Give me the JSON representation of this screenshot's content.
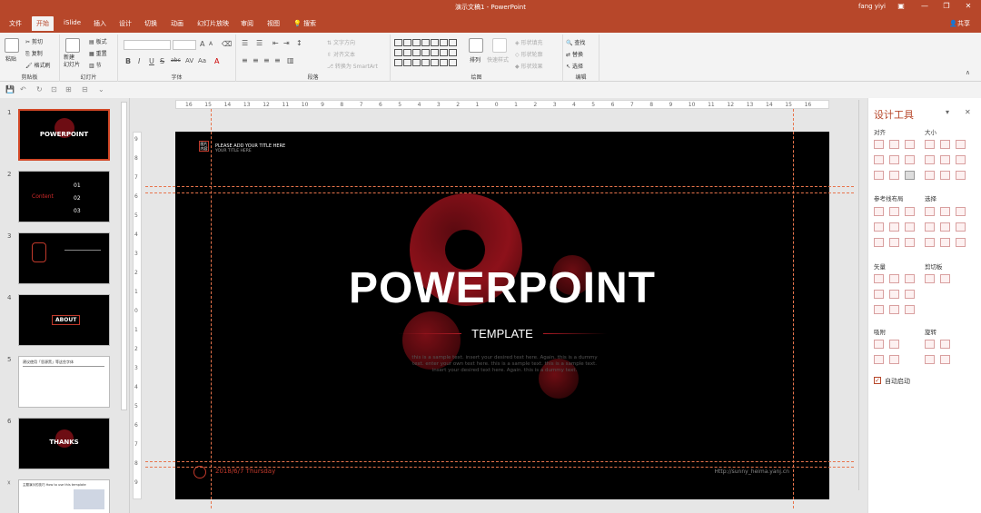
{
  "window": {
    "title": "演示文稿1 - PowerPoint",
    "user": "fang yiyi",
    "share_label": "共享"
  },
  "tabs": [
    "文件",
    "开始",
    "iSlide",
    "插入",
    "设计",
    "切换",
    "动画",
    "幻灯片放映",
    "审阅",
    "视图",
    "搜索"
  ],
  "active_tab": "开始",
  "ribbon": {
    "clipboard": {
      "paste": "粘贴",
      "cut": "剪切",
      "copy": "复制",
      "format_painter": "格式刷",
      "label": "剪贴板"
    },
    "slides": {
      "new_slide": "新建\n幻灯片",
      "layout": "板式",
      "reset": "重置",
      "section": "节",
      "label": "幻灯片"
    },
    "font": {
      "label": "字体",
      "bold": "B",
      "italic": "I",
      "underline": "U",
      "strike": "S",
      "abc": "abc",
      "aa": "Aa"
    },
    "paragraph": {
      "text_direction": "文字方向",
      "align_text": "对齐文本",
      "smartart": "转换为 SmartArt",
      "label": "段落"
    },
    "drawing": {
      "arrange": "排列",
      "quick_styles": "快速样式",
      "shape_fill": "形状填充",
      "shape_outline": "形状轮廓",
      "shape_effects": "形状效果",
      "label": "绘图"
    },
    "editing": {
      "find": "查找",
      "replace": "替换",
      "select": "选择",
      "label": "编辑"
    }
  },
  "thumbnails": [
    {
      "num": "1",
      "title": "POWERPOINT",
      "selected": true
    },
    {
      "num": "2",
      "title": "Content",
      "items": [
        "01",
        "02",
        "03"
      ]
    },
    {
      "num": "3",
      "title": ""
    },
    {
      "num": "4",
      "title": "ABOUT"
    },
    {
      "num": "5",
      "title": "建议使用「思源黑」等这些字体"
    },
    {
      "num": "6",
      "title": "THANKS"
    },
    {
      "num": "7",
      "title": "主题演示的技巧 How to use this template"
    }
  ],
  "ruler": {
    "h_ticks": [
      "16",
      "15",
      "14",
      "13",
      "12",
      "11",
      "10",
      "9",
      "8",
      "7",
      "6",
      "5",
      "4",
      "3",
      "2",
      "1",
      "0",
      "1",
      "2",
      "3",
      "4",
      "5",
      "6",
      "7",
      "8",
      "9",
      "10",
      "11",
      "12",
      "13",
      "14",
      "15",
      "16"
    ],
    "v_ticks": [
      "9",
      "8",
      "7",
      "6",
      "5",
      "4",
      "3",
      "2",
      "1",
      "0",
      "1",
      "2",
      "3",
      "4",
      "5",
      "6",
      "7",
      "8",
      "9"
    ]
  },
  "slide": {
    "logo_text": "图片\n内容",
    "header_line1": "PLEASE ADD YOUR TITLE HERE",
    "header_line2": "YOUR TITLE HERE",
    "title": "POWERPOINT",
    "subtitle": "TEMPLATE",
    "body": "this is a sample text. insert your desired text here. Again. this is a dummy text. enter your own text here. this is a sample text. this is a sample text. insert your desired text here. Again. this is a dummy text.",
    "date": "2018/6/7 Thursday",
    "url": "Http://sunny_heima.yanj.cn"
  },
  "design_panel": {
    "title": "设计工具",
    "sections": {
      "align": "对齐",
      "size": "大小",
      "ref_layout": "参考线布局",
      "select": "选择",
      "vector": "矢量",
      "clipboard": "剪切板",
      "snap": "吸附",
      "rotate": "旋转"
    },
    "autostart_label": "自动启动",
    "autostart_checked": true
  },
  "colors": {
    "accent": "#b7472a",
    "slide_bg": "#000000",
    "slide_red": "#b01b25",
    "guide": "#e8744c"
  }
}
